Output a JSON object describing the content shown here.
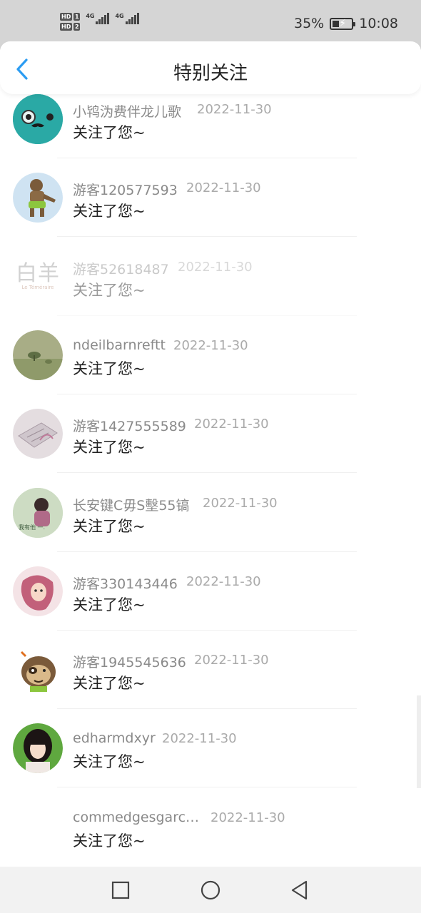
{
  "status_bar": {
    "hd1": "HD",
    "hd1_num": "1",
    "hd2": "HD",
    "hd2_num": "2",
    "net1": "4G",
    "net2": "4G",
    "battery_percent": "35%",
    "battery_level": 0.35,
    "time": "10:08",
    "background": "#d5d5d5"
  },
  "header": {
    "title": "特别关注",
    "back_icon": "chevron-left-icon",
    "accent_color": "#2b9cf2"
  },
  "items": [
    {
      "name": "小鸨沩费伴龙儿歌",
      "date": "2022-11-30",
      "message": "关注了您~"
    },
    {
      "name": "游客120577593",
      "date": "2022-11-30",
      "message": "关注了您~"
    },
    {
      "name": "游客52618487",
      "date": "2022-11-30",
      "message": "关注了您~",
      "avatar_text": "白羊",
      "avatar_subtext": "Le Téméraire"
    },
    {
      "name": "ndeilbarnreftt",
      "date": "2022-11-30",
      "message": "关注了您~"
    },
    {
      "name": "游客1427555589",
      "date": "2022-11-30",
      "message": "关注了您~"
    },
    {
      "name": "长安键C毋S墼55镐",
      "date": "2022-11-30",
      "message": "关注了您~",
      "avatar_text": "我有他 一."
    },
    {
      "name": "游客330143446",
      "date": "2022-11-30",
      "message": "关注了您~"
    },
    {
      "name": "游客1945545636",
      "date": "2022-11-30",
      "message": "关注了您~"
    },
    {
      "name": "edharmdxyr",
      "date": "2022-11-30",
      "message": "关注了您~"
    },
    {
      "name": "commedgesgarc…",
      "date": "2022-11-30",
      "message": "关注了您~"
    }
  ],
  "system_nav": {
    "recent_icon": "square-icon",
    "home_icon": "circle-icon",
    "back_icon": "triangle-back-icon"
  }
}
